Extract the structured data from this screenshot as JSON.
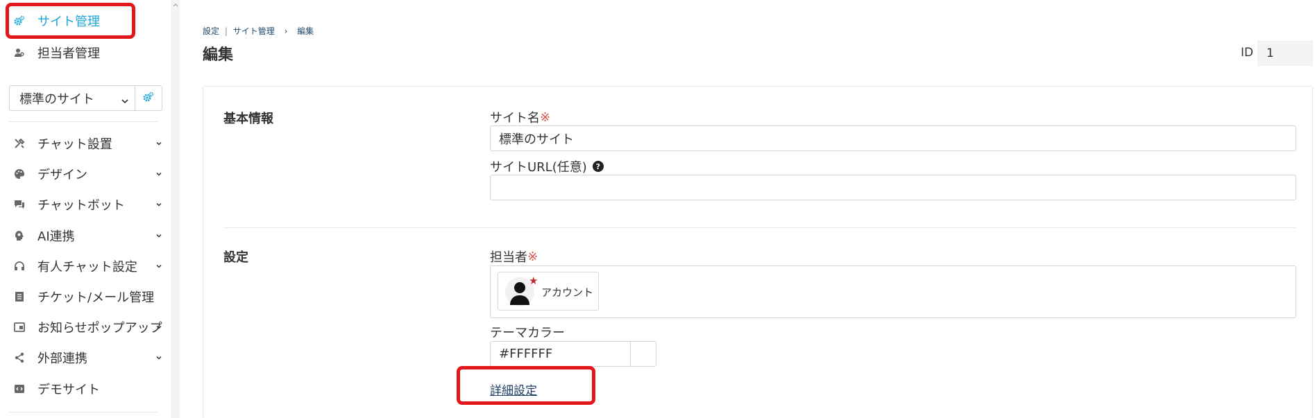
{
  "sidebar": {
    "top_items": [
      {
        "label": "サイト管理",
        "icon": "gear-icon",
        "active": true
      },
      {
        "label": "担当者管理",
        "icon": "users-icon",
        "active": false
      }
    ],
    "site_select": {
      "value": "標準のサイト"
    },
    "menu_items": [
      {
        "label": "チャット設置",
        "icon": "tools-icon",
        "has_chevron": true
      },
      {
        "label": "デザイン",
        "icon": "palette-icon",
        "has_chevron": true
      },
      {
        "label": "チャットボット",
        "icon": "chat-bubbles-icon",
        "has_chevron": true
      },
      {
        "label": "AI連携",
        "icon": "brain-icon",
        "has_chevron": true
      },
      {
        "label": "有人チャット設定",
        "icon": "headset-icon",
        "has_chevron": true
      },
      {
        "label": "チケット/メール管理",
        "icon": "list-icon",
        "has_chevron": false
      },
      {
        "label": "お知らせポップアップ",
        "icon": "window-icon",
        "has_chevron": true
      },
      {
        "label": "外部連携",
        "icon": "share-icon",
        "has_chevron": true
      },
      {
        "label": "デモサイト",
        "icon": "code-window-icon",
        "has_chevron": false
      }
    ]
  },
  "breadcrumb": {
    "item1": "設定",
    "separator1": "|",
    "item2": "サイト管理",
    "separator2": "›",
    "item3": "編集"
  },
  "page": {
    "title": "編集",
    "id_label": "ID",
    "id_value": "1"
  },
  "basic_info": {
    "section_title": "基本情報",
    "site_name_label": "サイト名",
    "required_mark": "※",
    "site_name_value": "標準のサイト",
    "site_url_label": "サイトURL(任意)",
    "site_url_value": "",
    "help_icon_glyph": "?"
  },
  "settings": {
    "section_title": "設定",
    "assignee_label": "担当者",
    "required_mark": "※",
    "assignee": {
      "name": "アカウント"
    },
    "theme_color_label": "テーマカラー",
    "theme_color_value": "#FFFFFF",
    "detail_link": "詳細設定"
  },
  "colors": {
    "accent": "#1aa6d9",
    "highlight": "#e3171b",
    "required": "#d9534f",
    "swatch": "#ffffff"
  }
}
